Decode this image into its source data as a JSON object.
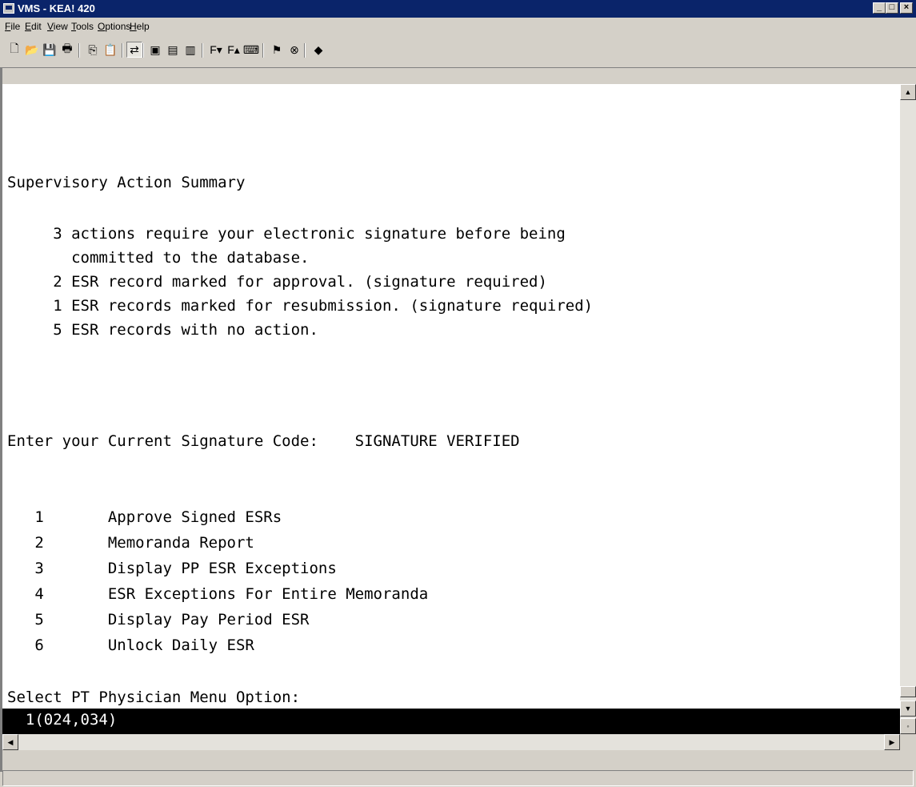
{
  "window": {
    "title": "VMS - KEA! 420",
    "controls": [
      "minimize",
      "maximize",
      "close"
    ]
  },
  "menu": {
    "items": [
      {
        "label": "File",
        "accel": "F",
        "rest": "ile"
      },
      {
        "label": "Edit",
        "accel": "E",
        "rest": "dit"
      },
      {
        "label": "View",
        "accel": "V",
        "rest": "iew"
      },
      {
        "label": "Tools",
        "accel": "T",
        "rest": "ools"
      },
      {
        "label": "Options",
        "accel": "O",
        "rest": "ptions"
      },
      {
        "label": "Help",
        "accel": "H",
        "rest": "elp"
      }
    ]
  },
  "toolbar": {
    "icons": [
      "new-document-icon",
      "open-folder-icon",
      "save-icon",
      "print-icon",
      "copy-icon",
      "paste-icon",
      "connect-icon",
      "session-icon",
      "open-session-icon",
      "close-session-icon",
      "font-smaller-icon",
      "font-larger-icon",
      "keyboard-icon",
      "traffic-light-icon",
      "stop-icon",
      "help-book-icon"
    ]
  },
  "terminal": {
    "heading": "Supervisory Action Summary",
    "summary": [
      "     3 actions require your electronic signature before being",
      "       committed to the database.",
      "     2 ESR record marked for approval. (signature required)",
      "     1 ESR records marked for resubmission. (signature required)",
      "     5 ESR records with no action."
    ],
    "signature_prompt": "Enter your Current Signature Code:    SIGNATURE VERIFIED",
    "menu_options": [
      {
        "num": "1",
        "label": "Approve Signed ESRs"
      },
      {
        "num": "2",
        "label": "Memoranda Report"
      },
      {
        "num": "3",
        "label": "Display PP ESR Exceptions"
      },
      {
        "num": "4",
        "label": "ESR Exceptions For Entire Memoranda"
      },
      {
        "num": "5",
        "label": "Display Pay Period ESR"
      },
      {
        "num": "6",
        "label": "Unlock Daily ESR"
      }
    ],
    "select_prompt": "Select PT Physician Menu Option:",
    "input_line": "  1(024,034)"
  },
  "colors": {
    "titlebar": "#0a246a",
    "chrome": "#d4d0c8",
    "terminal_bg": "#ffffff",
    "input_bar": "#000000"
  }
}
